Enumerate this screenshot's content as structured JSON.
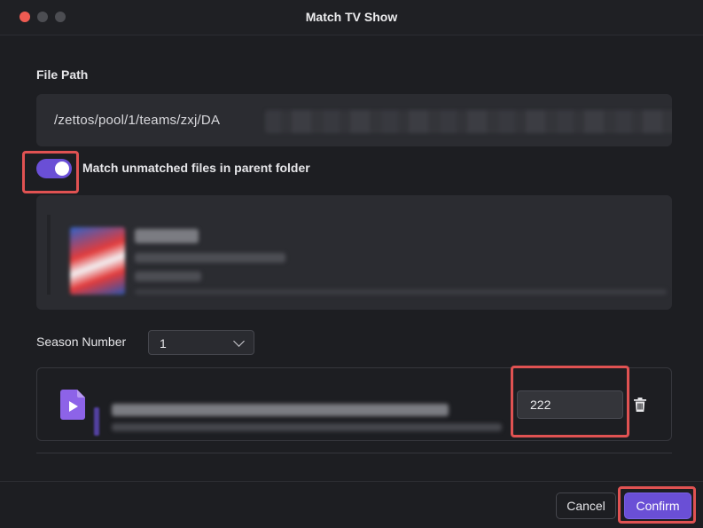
{
  "window": {
    "title": "Match TV Show"
  },
  "file_path": {
    "label": "File Path",
    "value": "/zettos/pool/1/teams/zxj/DA"
  },
  "match_parent": {
    "label": "Match unmatched files in parent folder",
    "enabled": true
  },
  "season": {
    "label": "Season Number",
    "selected": "1"
  },
  "episode": {
    "value": "222"
  },
  "footer": {
    "cancel_label": "Cancel",
    "confirm_label": "Confirm"
  },
  "colors": {
    "accent": "#6a4fd6",
    "highlight": "#e05252",
    "background": "#1d1e22"
  },
  "icons": {
    "file": "video-file-icon",
    "delete": "trash-icon",
    "select": "chevron-down-icon"
  }
}
